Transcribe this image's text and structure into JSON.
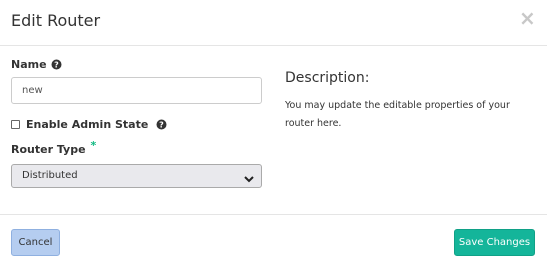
{
  "header": {
    "title": "Edit Router",
    "close_glyph": "×"
  },
  "form": {
    "name_label": "Name",
    "name_value": "new",
    "admin_state_label": "Enable Admin State",
    "admin_state_checked": false,
    "router_type_label": "Router Type",
    "required_mark": "*",
    "router_type_value": "Distributed"
  },
  "description": {
    "heading": "Description:",
    "text": "You may update the editable properties of your router here."
  },
  "footer": {
    "cancel_label": "Cancel",
    "save_label": "Save Changes"
  },
  "colors": {
    "primary": "#14b59a",
    "cancel": "#b5cdf0",
    "required": "#10b981"
  },
  "icons": {
    "help": "question-circle-icon",
    "close": "close-icon",
    "caret": "chevron-down-icon"
  }
}
